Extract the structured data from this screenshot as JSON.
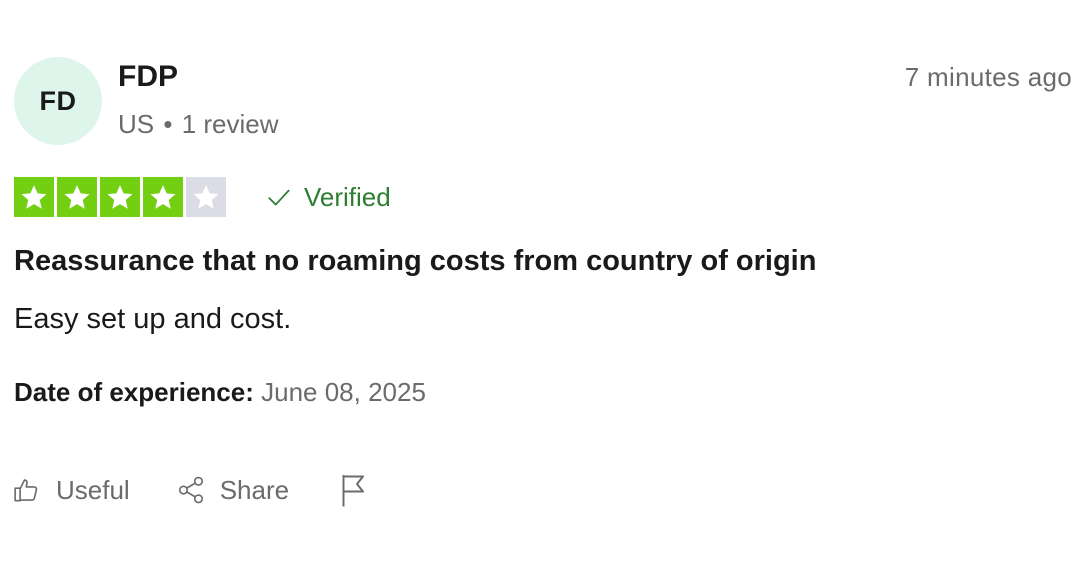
{
  "reviewer": {
    "initials": "FD",
    "name": "FDP",
    "country": "US",
    "separator": "•",
    "review_count": "1 review"
  },
  "timestamp": "7 minutes ago",
  "rating": {
    "stars": 4,
    "max": 5,
    "on_color": "#73cf11",
    "off_color": "#dcdce6"
  },
  "verified_label": "Verified",
  "review": {
    "title": "Reassurance that no roaming costs from country of origin",
    "body": "Easy set up and cost."
  },
  "experience": {
    "label": "Date of experience:",
    "date": "June 08, 2025"
  },
  "actions": {
    "useful_label": "Useful",
    "share_label": "Share",
    "useful_icon": "thumbs-up-icon",
    "share_icon": "share-icon",
    "flag_icon": "flag-icon"
  }
}
